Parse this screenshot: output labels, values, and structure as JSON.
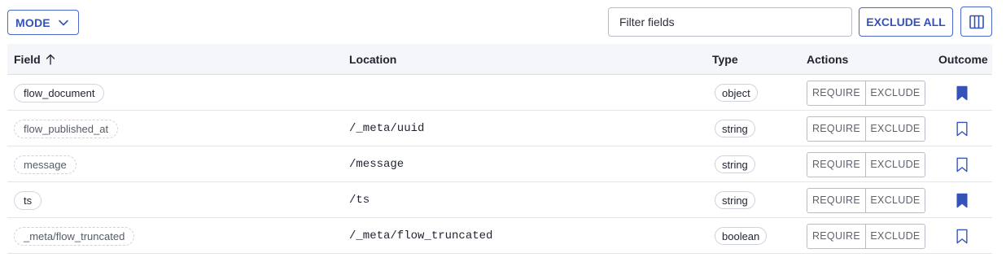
{
  "toolbar": {
    "mode_label": "MODE",
    "filter_placeholder": "Filter fields",
    "exclude_all_label": "EXCLUDE ALL",
    "columns_icon": "view-column-icon",
    "accent_color": "#3552b8"
  },
  "table": {
    "headers": {
      "field": "Field",
      "location": "Location",
      "type": "Type",
      "actions": "Actions",
      "outcome": "Outcome"
    },
    "sort_icon": "arrow-up-icon",
    "rows": [
      {
        "field": "flow_document",
        "field_style": "solid",
        "location": "",
        "type": "object",
        "require": "REQUIRE",
        "exclude": "EXCLUDE",
        "outcome": "bookmark-filled-icon"
      },
      {
        "field": "flow_published_at",
        "field_style": "dashed",
        "location": "/_meta/uuid",
        "type": "string",
        "require": "REQUIRE",
        "exclude": "EXCLUDE",
        "outcome": "bookmark-outline-icon"
      },
      {
        "field": "message",
        "field_style": "dashed",
        "location": "/message",
        "type": "string",
        "require": "REQUIRE",
        "exclude": "EXCLUDE",
        "outcome": "bookmark-outline-icon"
      },
      {
        "field": "ts",
        "field_style": "solid",
        "location": "/ts",
        "type": "string",
        "require": "REQUIRE",
        "exclude": "EXCLUDE",
        "outcome": "bookmark-filled-icon"
      },
      {
        "field": "_meta/flow_truncated",
        "field_style": "dashed",
        "location": "/_meta/flow_truncated",
        "type": "boolean",
        "require": "REQUIRE",
        "exclude": "EXCLUDE",
        "outcome": "bookmark-outline-icon"
      }
    ]
  }
}
